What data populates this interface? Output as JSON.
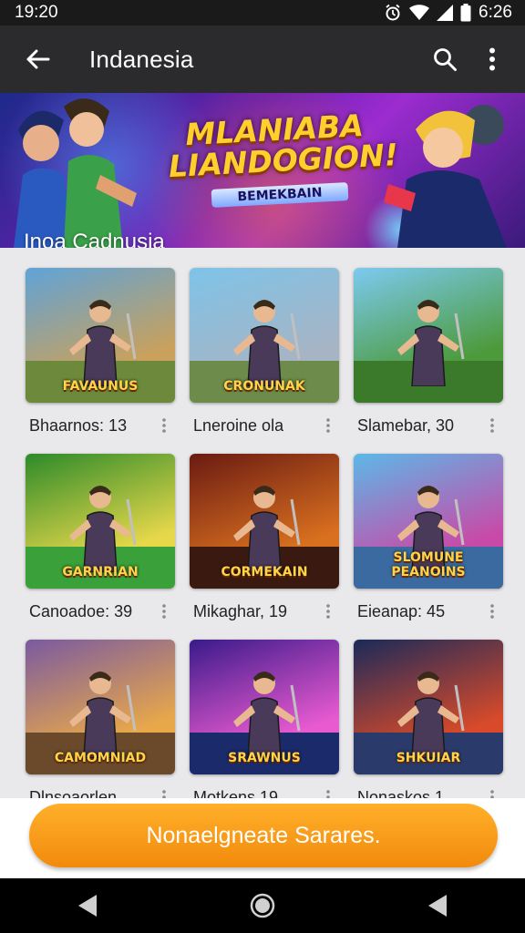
{
  "status_bar": {
    "time": "19:20",
    "right_time": "6:26"
  },
  "app_bar": {
    "title": "Indanesia"
  },
  "banner": {
    "logo_line1": "MLANIABA",
    "logo_line2": "LIANDOGION!",
    "logo_sub": "BEMEKBAIN",
    "caption": "Inoa Cadnusia"
  },
  "games": [
    {
      "name": "Bhaarnos: 13",
      "thumb_text": "FAVAUNUS",
      "colors": [
        "#5fa3d8",
        "#c9a15c",
        "#6d8a3c"
      ]
    },
    {
      "name": "Lneroine ola",
      "thumb_text": "CRONUNAK",
      "colors": [
        "#7ec3e8",
        "#a7b4c4",
        "#6d8b4a"
      ]
    },
    {
      "name": "Slamebar, 30",
      "thumb_text": "",
      "colors": [
        "#7ccaf0",
        "#4c9a3a",
        "#3b7a2a"
      ]
    },
    {
      "name": "Canoadoe: 39",
      "thumb_text": "GARNRIAN",
      "colors": [
        "#2d8a2a",
        "#e7d84a",
        "#3aa03a"
      ]
    },
    {
      "name": "Mikaghar, 19",
      "thumb_text": "CORMEKAIN",
      "colors": [
        "#6a1a12",
        "#d9701f",
        "#3a1a10"
      ]
    },
    {
      "name": "Eieanap: 45",
      "thumb_text": "SLOMUNE PEANOINS",
      "colors": [
        "#5cb8e8",
        "#c84aa8",
        "#3a6aa0"
      ]
    },
    {
      "name": "Dlnsoaorlen",
      "thumb_text": "CAMOMNIAD",
      "colors": [
        "#7a5aa0",
        "#e8a84a",
        "#6a4a2a"
      ]
    },
    {
      "name": "Motkens 19",
      "thumb_text": "SRAWNUS",
      "colors": [
        "#3a1a8a",
        "#e85ad0",
        "#1a2a6a"
      ]
    },
    {
      "name": "Nonaskos 1",
      "thumb_text": "SHKUIAR",
      "colors": [
        "#1a2a5a",
        "#d84a2a",
        "#2a3a6a"
      ]
    }
  ],
  "cta": {
    "label": "Nonaelgneate Sarares."
  }
}
